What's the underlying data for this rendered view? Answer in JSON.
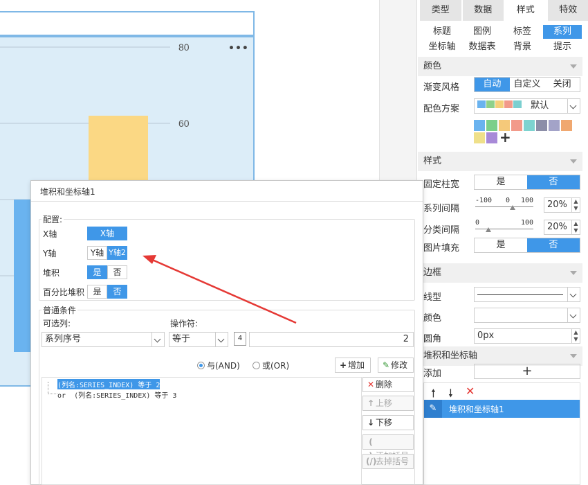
{
  "chart": {
    "y_ticks": [
      "80",
      "60"
    ],
    "more_icon": "more-dots-icon"
  },
  "chart_data": {
    "type": "bar",
    "categories": [
      "",
      ""
    ],
    "series": [
      {
        "values": [
          62
        ]
      },
      {
        "values": [
          40
        ]
      }
    ],
    "ylim": [
      0,
      80
    ],
    "grid": true
  },
  "panel": {
    "main_tabs": [
      "类型",
      "数据",
      "样式",
      "特效"
    ],
    "main_tab_active": 2,
    "sub_tabs": [
      "标题",
      "图例",
      "标签",
      "系列",
      "坐标轴",
      "数据表",
      "背景",
      "提示"
    ],
    "sub_tab_active": 3,
    "color_section": "颜色",
    "gradient_label": "渐变风格",
    "gradient_options": [
      "自动",
      "自定义",
      "关闭"
    ],
    "scheme_label": "配色方案",
    "scheme_value": "默认",
    "scheme_swatches": [
      "#6ab3ef",
      "#8fd18a",
      "#f5d07a",
      "#f29a8a",
      "#7bcfd0"
    ],
    "palette": [
      "#6ab3ef",
      "#7ccf8a",
      "#f5c97a",
      "#f29a8a",
      "#7dd3d0",
      "#8c8ea8",
      "#a3a3c8",
      "#f0a870",
      "#efe08a",
      "#a88ad8"
    ],
    "add_symbol": "+",
    "style_section": "样式",
    "fixed_width_label": "固定柱宽",
    "fixed_width_options": [
      "是",
      "否"
    ],
    "series_gap_label": "系列间隔",
    "series_gap_min": "-100",
    "series_gap_mid": "0",
    "series_gap_max": "100",
    "series_gap_value": "20%",
    "category_gap_label": "分类间隔",
    "category_gap_min": "0",
    "category_gap_max": "100",
    "category_gap_value": "20%",
    "image_fill_label": "图片填充",
    "image_fill_options": [
      "是",
      "否"
    ],
    "border_section": "边框",
    "line_type_label": "线型",
    "border_color_label": "颜色",
    "radius_label": "圆角",
    "radius_value": "0px",
    "stack_section": "堆积和坐标轴",
    "add_label": "添加",
    "add_button": "+",
    "list_item": "堆积和坐标轴1"
  },
  "dialog": {
    "title": "堆积和坐标轴1",
    "config_group": "配置:",
    "x_axis_label": "X轴",
    "x_axis_option": "X轴",
    "y_axis_label": "Y轴",
    "y_axis_options": [
      "Y轴",
      "Y轴2"
    ],
    "stack_label": "堆积",
    "stack_options": [
      "是",
      "否"
    ],
    "pct_stack_label": "百分比堆积",
    "pct_stack_options": [
      "是",
      "否"
    ],
    "cond_group": "普通条件",
    "column_label": "可选列:",
    "column_value": "系列序号",
    "operator_label": "操作符:",
    "operator_value": "等于",
    "type_icon_text": "4",
    "value_input": "2",
    "and_label": "与(AND)",
    "or_label": "或(OR)",
    "add_btn": "增加",
    "edit_btn": "修改",
    "conditions": [
      "(列名:SERIES_INDEX) 等于 2",
      "or  (列名:SERIES_INDEX) 等于 3"
    ],
    "delete_btn": "删除",
    "up_btn": "上移",
    "down_btn": "下移",
    "add_paren_btn": "添加括号",
    "remove_paren_btn": "去掉括号"
  }
}
